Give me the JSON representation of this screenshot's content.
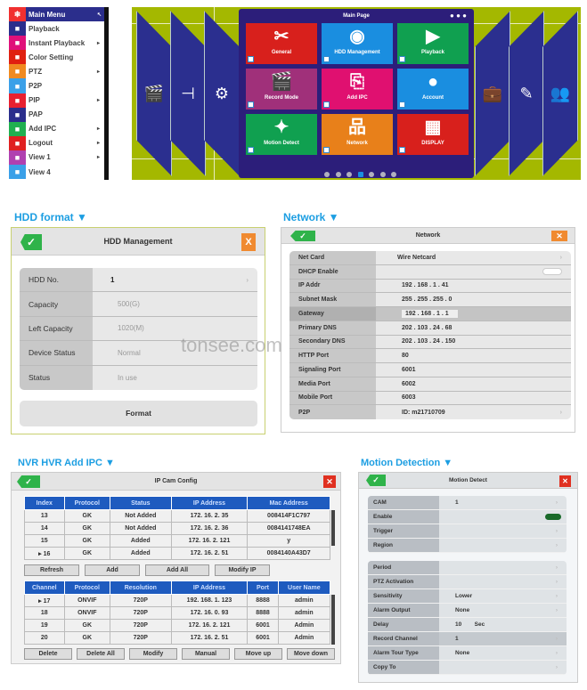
{
  "main_menu": {
    "title": "Main Menu",
    "items": [
      {
        "label": "Playback",
        "icon": "play-icon",
        "color": "#2b2e8c",
        "arrow": false
      },
      {
        "label": "Instant Playback",
        "icon": "instant-playback-icon",
        "color": "#e0107a",
        "arrow": true
      },
      {
        "label": "Color Setting",
        "icon": "monitor-icon",
        "color": "#e02010",
        "arrow": false
      },
      {
        "label": "PTZ",
        "icon": "ptz-icon",
        "color": "#f08a20",
        "arrow": true
      },
      {
        "label": "P2P",
        "icon": "network-icon",
        "color": "#3aa0e8",
        "arrow": false
      },
      {
        "label": "PIP",
        "icon": "pip-icon",
        "color": "#e82030",
        "arrow": true
      },
      {
        "label": "PAP",
        "icon": "pap-icon",
        "color": "#2b2e8c",
        "arrow": false
      },
      {
        "label": "Add IPC",
        "icon": "add-ipc-icon",
        "color": "#20b050",
        "arrow": true
      },
      {
        "label": "Logout",
        "icon": "power-icon",
        "color": "#e02020",
        "arrow": true
      },
      {
        "label": "View 1",
        "icon": "view1-icon",
        "color": "#b040b0",
        "arrow": true
      },
      {
        "label": "View 4",
        "icon": "view4-icon",
        "color": "#3aa0e8",
        "arrow": false
      }
    ],
    "head_color": "#f03030"
  },
  "main_page": {
    "title": "Main Page",
    "tiles": [
      {
        "label": "General",
        "color": "#d8201c",
        "glyph": "✂"
      },
      {
        "label": "HDD Management",
        "color": "#1a8ee0",
        "glyph": "◉"
      },
      {
        "label": "Playback",
        "color": "#10a050",
        "glyph": "▶"
      },
      {
        "label": "Record Mode",
        "color": "#a0307a",
        "glyph": "🎬"
      },
      {
        "label": "Add IPC",
        "color": "#e01070",
        "glyph": "⎘"
      },
      {
        "label": "Account",
        "color": "#1a8ee0",
        "glyph": "●"
      },
      {
        "label": "Motion Detect",
        "color": "#10a050",
        "glyph": "✦"
      },
      {
        "label": "Network",
        "color": "#e8801a",
        "glyph": "品"
      },
      {
        "label": "DISPLAY",
        "color": "#d8201c",
        "glyph": "▦"
      }
    ],
    "pages": 7,
    "current_page": 4
  },
  "hdd": {
    "section": "HDD format ▼",
    "title": "HDD Management",
    "close": "X",
    "rows": [
      {
        "k": "HDD No.",
        "v": "1"
      },
      {
        "k": "Capacity",
        "v": "500(G)"
      },
      {
        "k": "Left Capacity",
        "v": "1020(M)"
      },
      {
        "k": "Device Status",
        "v": "Normal"
      },
      {
        "k": "Status",
        "v": "In use"
      }
    ],
    "format": "Format"
  },
  "network": {
    "section": "Network ▼",
    "title": "Network",
    "close": "✕",
    "rows": [
      {
        "k": "Net Card",
        "v": "Wire Netcard"
      },
      {
        "k": "DHCP Enable",
        "v": ""
      },
      {
        "k": "IP Addr",
        "v": "192 . 168 .   1 .  41"
      },
      {
        "k": "Subnet Mask",
        "v": "255 . 255 . 255 .   0"
      },
      {
        "k": "Gateway",
        "v": "192 . 168 .   1 .   1"
      },
      {
        "k": "Primary DNS",
        "v": "202 . 103 .  24 .  68"
      },
      {
        "k": "Secondary DNS",
        "v": "202 . 103 .  24 . 150"
      },
      {
        "k": "HTTP Port",
        "v": "80"
      },
      {
        "k": "Signaling Port",
        "v": "6001"
      },
      {
        "k": "Media Port",
        "v": "6002"
      },
      {
        "k": "Mobile Port",
        "v": "6003"
      },
      {
        "k": "P2P",
        "v": "ID: m21710709"
      }
    ]
  },
  "ipc": {
    "section": "NVR HVR Add IPC ▼",
    "title": "IP Cam Config",
    "close": "✕",
    "top_headers": [
      "Index",
      "Protocol",
      "Status",
      "IP Address",
      "Mac Address"
    ],
    "top_rows": [
      [
        "13",
        "GK",
        "Not Added",
        "172. 16. 2. 35",
        "008414F1C797"
      ],
      [
        "14",
        "GK",
        "Not Added",
        "172. 16. 2. 36",
        "0084141748EA"
      ],
      [
        "15",
        "GK",
        "Added",
        "172. 16. 2. 121",
        "y"
      ],
      [
        "▸ 16",
        "GK",
        "Added",
        "172. 16. 2. 51",
        "0084140A43D7"
      ]
    ],
    "top_buttons": [
      "Refresh",
      "Add",
      "Add All",
      "Modify IP"
    ],
    "bottom_headers": [
      "Channel",
      "Protocol",
      "Resolution",
      "IP Address",
      "Port",
      "User Name"
    ],
    "bottom_rows": [
      [
        "▸ 17",
        "ONVIF",
        "720P",
        "192. 168. 1. 123",
        "8888",
        "admin"
      ],
      [
        "18",
        "ONVIF",
        "720P",
        "172. 16. 0. 93",
        "8888",
        "admin"
      ],
      [
        "19",
        "GK",
        "720P",
        "172. 16. 2. 121",
        "6001",
        "Admin"
      ],
      [
        "20",
        "GK",
        "720P",
        "172. 16. 2. 51",
        "6001",
        "Admin"
      ]
    ],
    "bottom_buttons": [
      "Delete",
      "Delete All",
      "Modify",
      "Manual",
      "Move up",
      "Move down"
    ]
  },
  "motion": {
    "section": "Motion Detection ▼",
    "title": "Motion Detect",
    "close": "✕",
    "group1": [
      {
        "k": "CAM",
        "v": "1"
      },
      {
        "k": "Enable",
        "v": ""
      },
      {
        "k": "Trigger",
        "v": ""
      },
      {
        "k": "Region",
        "v": ""
      }
    ],
    "group2": [
      {
        "k": "Period",
        "v": ""
      },
      {
        "k": "PTZ Activation",
        "v": ""
      },
      {
        "k": "Sensitivity",
        "v": "Lower"
      },
      {
        "k": "Alarm Output",
        "v": "None"
      },
      {
        "k": "Delay",
        "v": "10        Sec"
      },
      {
        "k": "Record Channel",
        "v": "1"
      },
      {
        "k": "Alarm Tour Type",
        "v": "None"
      },
      {
        "k": "Copy To",
        "v": ""
      }
    ]
  },
  "watermark": "tonsee.com"
}
